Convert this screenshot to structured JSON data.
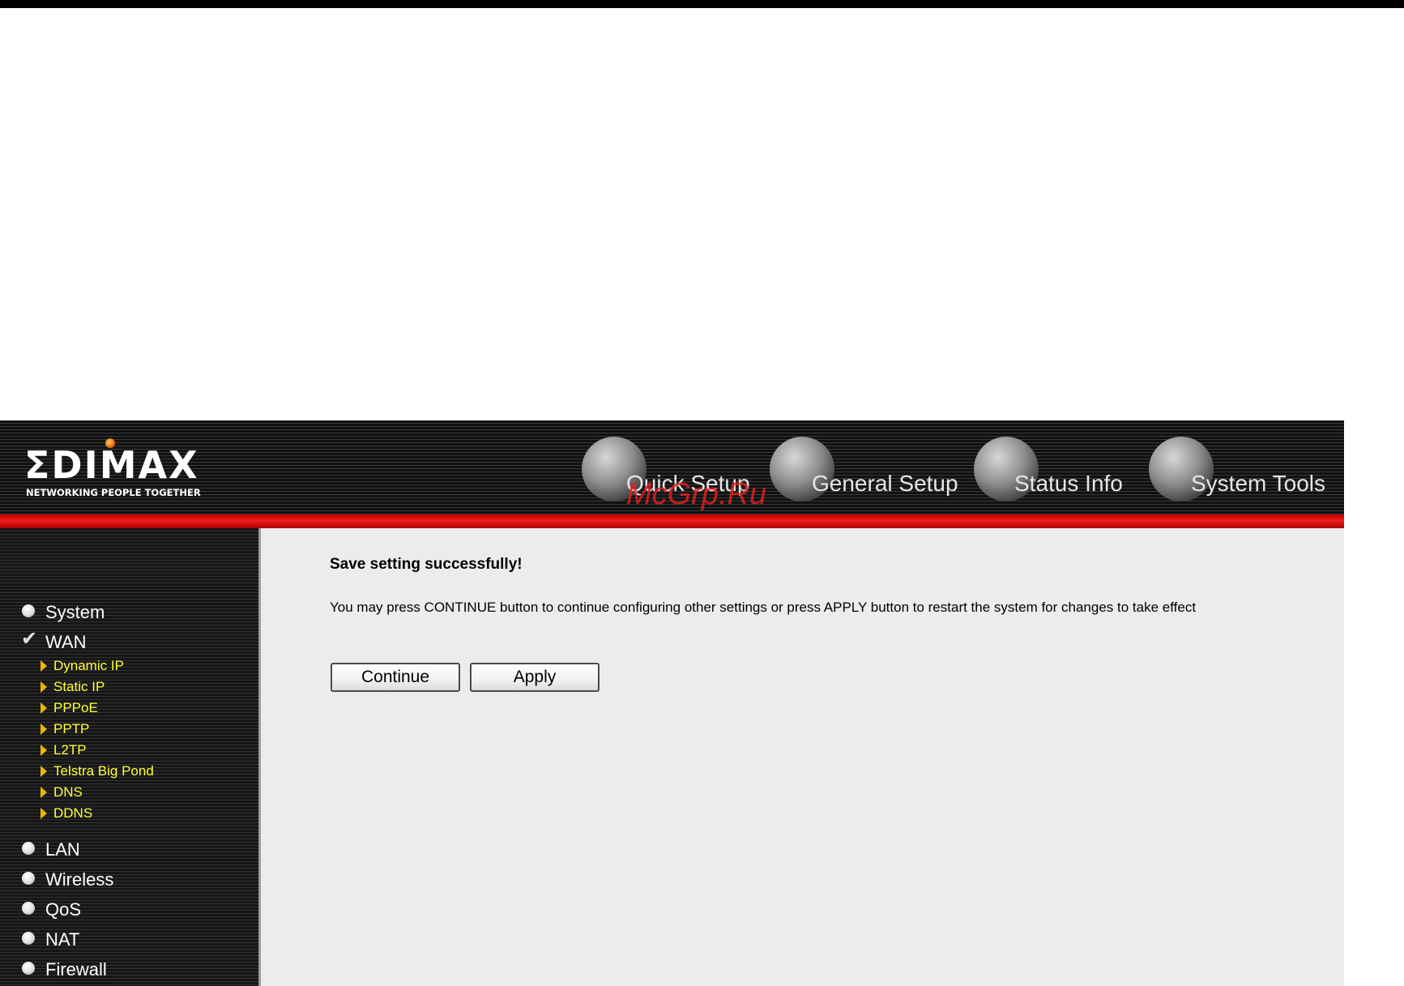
{
  "header": {
    "logo_text": "ΣDIMAX",
    "logo_tagline": "NETWORKING PEOPLE TOGETHER",
    "nav": [
      {
        "label": "Quick Setup",
        "icon": "mouse-icon"
      },
      {
        "label": "General Setup",
        "icon": "keyboard-icon"
      },
      {
        "label": "Status Info",
        "icon": "network-plug-icon"
      },
      {
        "label": "System Tools",
        "icon": "system-tools-icon"
      }
    ],
    "watermark": "McGrp.Ru"
  },
  "sidebar": {
    "items": [
      {
        "label": "System",
        "state": "radio"
      },
      {
        "label": "WAN",
        "state": "checked"
      },
      {
        "label": "LAN",
        "state": "radio"
      },
      {
        "label": "Wireless",
        "state": "radio"
      },
      {
        "label": "QoS",
        "state": "radio"
      },
      {
        "label": "NAT",
        "state": "radio"
      },
      {
        "label": "Firewall",
        "state": "radio"
      }
    ],
    "wan_subitems": [
      {
        "label": "Dynamic IP"
      },
      {
        "label": "Static IP"
      },
      {
        "label": "PPPoE"
      },
      {
        "label": "PPTP"
      },
      {
        "label": "L2TP"
      },
      {
        "label": "Telstra Big Pond"
      },
      {
        "label": "DNS"
      },
      {
        "label": "DDNS"
      }
    ]
  },
  "main": {
    "title": "Save setting successfully!",
    "message": "You may press CONTINUE button to continue configuring other settings or press APPLY button to restart the system for changes to take effect",
    "continue_label": "Continue",
    "apply_label": "Apply"
  },
  "colors": {
    "accent_red": "#e01818",
    "submenu_yellow": "#ffff33",
    "content_bg": "#ececec"
  }
}
